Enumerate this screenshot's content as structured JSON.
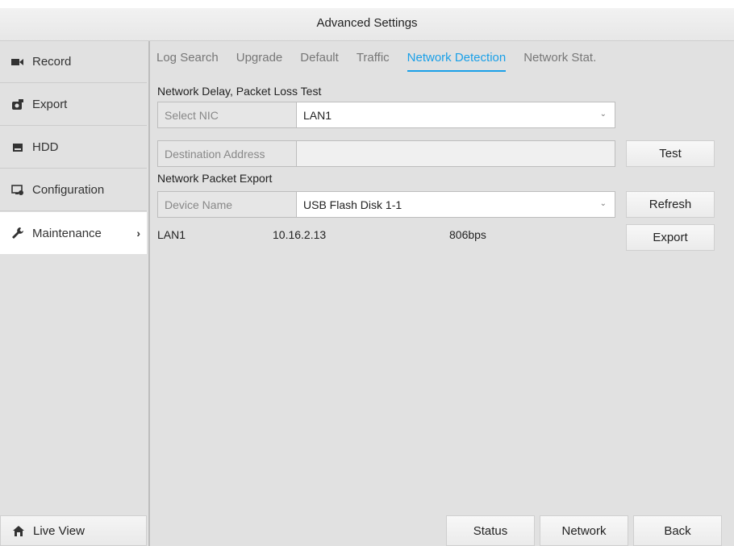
{
  "window": {
    "title": "Advanced Settings"
  },
  "sidebar": {
    "items": [
      {
        "label": "Record",
        "icon": "camera-icon"
      },
      {
        "label": "Export",
        "icon": "export-icon"
      },
      {
        "label": "HDD",
        "icon": "hdd-icon"
      },
      {
        "label": "Configuration",
        "icon": "configuration-icon"
      },
      {
        "label": "Maintenance",
        "icon": "wrench-icon",
        "active": true
      }
    ],
    "live_view": {
      "label": "Live View",
      "icon": "home-icon"
    }
  },
  "tabs": [
    "Log Search",
    "Upgrade",
    "Default",
    "Traffic",
    "Network Detection",
    "Network Stat."
  ],
  "active_tab": "Network Detection",
  "delay_test": {
    "title": "Network Delay, Packet Loss Test",
    "select_nic_label": "Select NIC",
    "select_nic_value": "LAN1",
    "destination_label": "Destination Address",
    "destination_value": "",
    "test_button": "Test"
  },
  "packet_export": {
    "title": "Network Packet Export",
    "device_label": "Device Name",
    "device_value": "USB Flash Disk 1-1",
    "refresh_button": "Refresh",
    "export_button": "Export",
    "stats": {
      "nic": "LAN1",
      "ip": "10.16.2.13",
      "rate": "806bps"
    }
  },
  "footer": {
    "status": "Status",
    "network": "Network",
    "back": "Back"
  },
  "colors": {
    "accent": "#1aa0e8",
    "background": "#e1e1e1",
    "active_item": "#ffffff"
  }
}
